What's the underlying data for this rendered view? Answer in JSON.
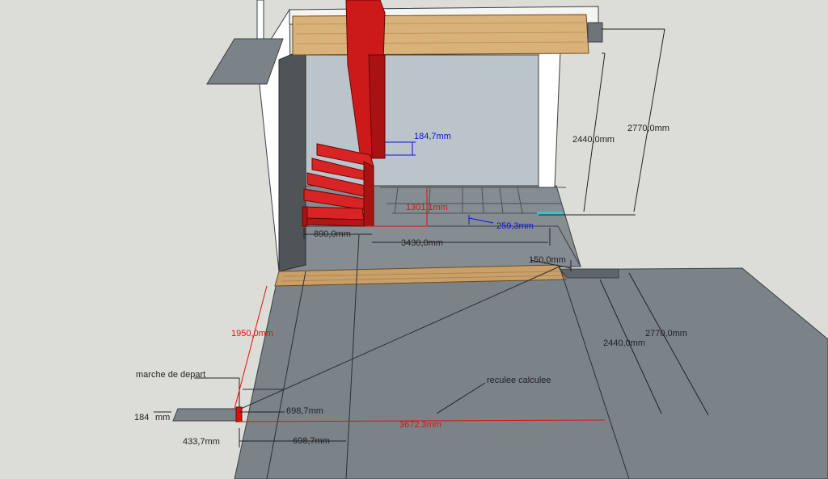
{
  "colors": {
    "background": "#ddddd8",
    "floor": "#7b8389",
    "wall_front": "#ffffff",
    "wall_side": "#4f5457",
    "wall_back": "#bac4ca",
    "wood": "#d9b27a",
    "stair": "#cc1a1a",
    "dim_black": "#222222",
    "dim_red": "#e01010",
    "dim_blue": "#1010e0",
    "accent_teal": "#3ec2c4"
  },
  "labels": {
    "upper_height_outer": "2770,0mm",
    "upper_height_inner": "2440,0mm",
    "riser_blue": "184,7mm",
    "height_red": "1301,1mm",
    "tread_blue": "259,3mm",
    "width_890": "890,0mm",
    "width_3430": "3430,0mm",
    "offset_150": "150,0mm",
    "lower_height_outer": "2770,0mm",
    "lower_height_inner": "2440,0mm",
    "depth_red": "1950,0mm",
    "marche_de_depart": "marche de depart",
    "reculee_calculee": "reculee calculee",
    "going_upper": "698,7mm",
    "run_red": "3672,3mm",
    "riser_left": "184",
    "riser_left_unit": "mm",
    "offset_433": "433,7mm",
    "going_lower": "698,7mm"
  }
}
